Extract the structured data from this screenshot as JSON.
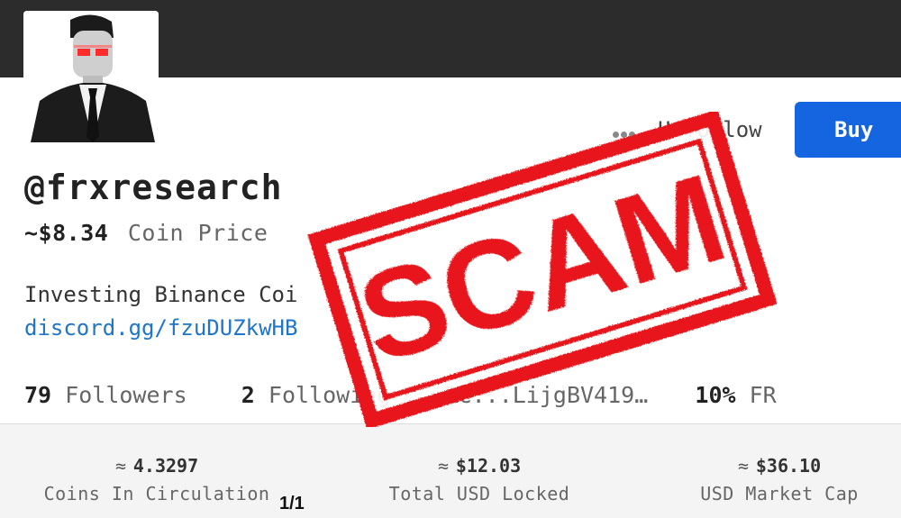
{
  "profile": {
    "handle": "@frxresearch",
    "coin_price": "~$8.34",
    "coin_price_label": "Coin Price",
    "bio": "Investing Binance Coi",
    "bio_link": "discord.gg/fzuDUZkwHB"
  },
  "actions": {
    "more_icon": "more-dots-icon",
    "unfollow_label": "Unfollow",
    "buy_label": "Buy",
    "buy_color": "#1565e0"
  },
  "stats": {
    "followers_count": "79",
    "followers_label": "Followers",
    "following_count": "2",
    "following_label": "Following",
    "address_fragment": "RC...LijgBV419…",
    "fr_value": "10%",
    "fr_label": "FR"
  },
  "metrics": [
    {
      "value": "4.3297",
      "label": "Coins In Circulation"
    },
    {
      "value": "$12.03",
      "label": "Total USD Locked"
    },
    {
      "value": "$36.10",
      "label": "USD Market Cap"
    }
  ],
  "approx_symbol": "≈",
  "pager": "1/1",
  "overlay": {
    "stamp_text": "SCAM",
    "stamp_color": "#e8141b"
  }
}
